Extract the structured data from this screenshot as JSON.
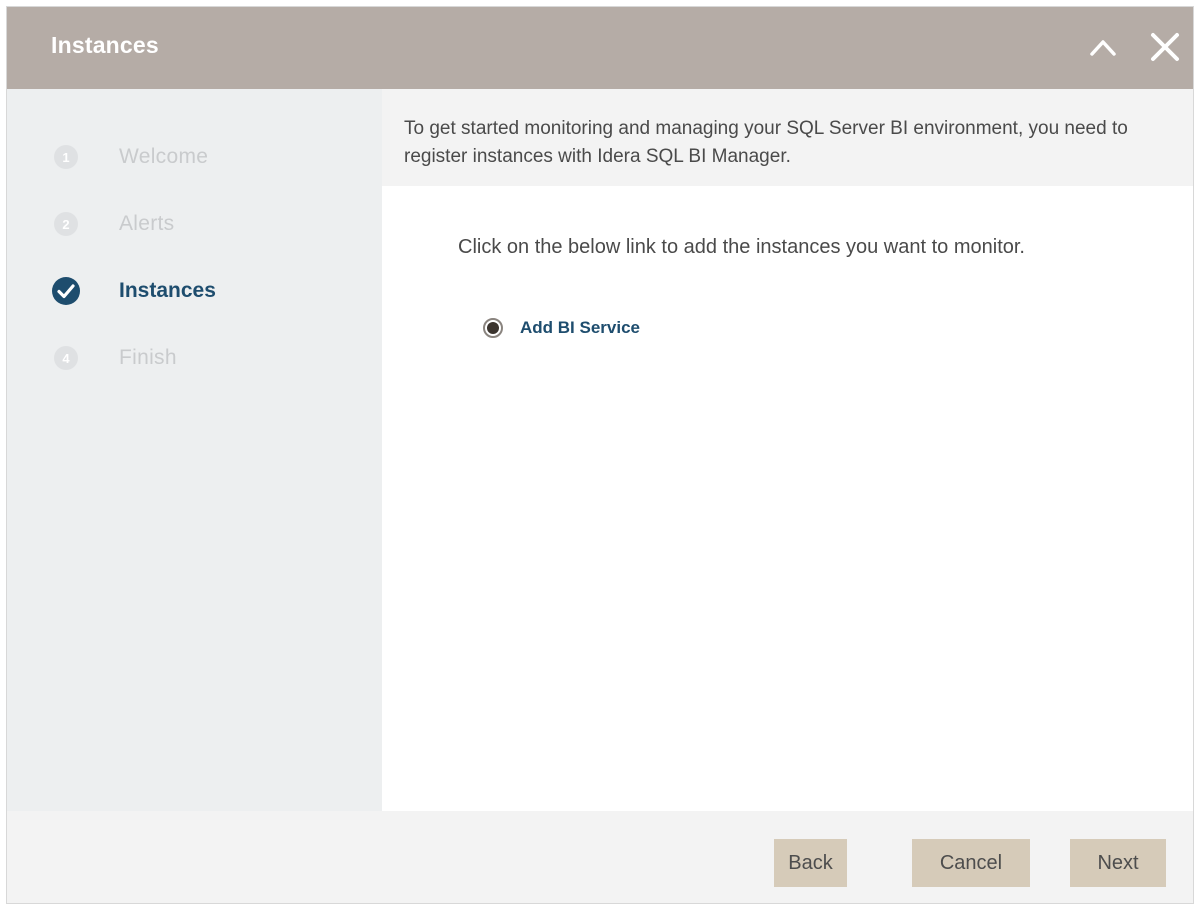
{
  "dialog": {
    "title": "Instances"
  },
  "titlebar": {
    "collapse_icon": "chevron-up-icon",
    "close_icon": "close-icon"
  },
  "steps": [
    {
      "number": "1",
      "label": "Welcome",
      "state": "inactive"
    },
    {
      "number": "2",
      "label": "Alerts",
      "state": "inactive"
    },
    {
      "number": "",
      "label": "Instances",
      "state": "active",
      "icon": "check-circle-icon"
    },
    {
      "number": "4",
      "label": "Finish",
      "state": "inactive"
    }
  ],
  "intro": {
    "text": "To get started monitoring and managing your SQL Server BI environment, you need to register instances with Idera SQL BI Manager."
  },
  "content": {
    "instruction": "Click on the below link to add the instances you want to monitor.",
    "option_label": "Add BI Service",
    "option_selected": true
  },
  "footer": {
    "back_label": "Back",
    "cancel_label": "Cancel",
    "next_label": "Next"
  },
  "colors": {
    "titlebar": "#b5aca6",
    "sidebar": "#edeff0",
    "accent": "#1e4d6e",
    "button": "#d6cbb9"
  }
}
